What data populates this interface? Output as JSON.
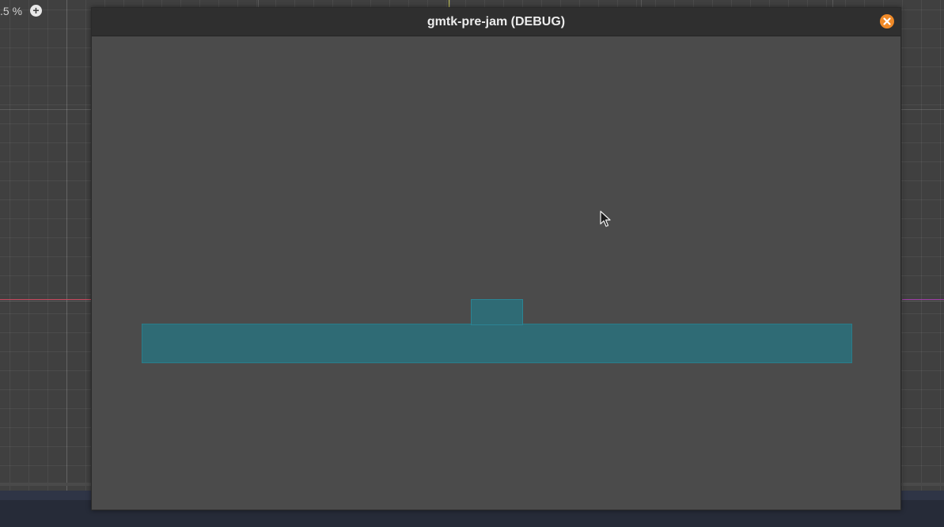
{
  "editor": {
    "zoom_label": ".5 %",
    "zoom_in_icon": "plus-circle-icon"
  },
  "window": {
    "title": "gmtk-pre-jam (DEBUG)",
    "close_icon": "close-icon",
    "close_color": "#f08a28"
  },
  "game": {
    "background_color": "#4b4b4b",
    "block_color": "#2f6b75",
    "objects": [
      "ground-platform",
      "player-block"
    ]
  },
  "cursor": {
    "icon": "mouse-pointer-icon"
  }
}
